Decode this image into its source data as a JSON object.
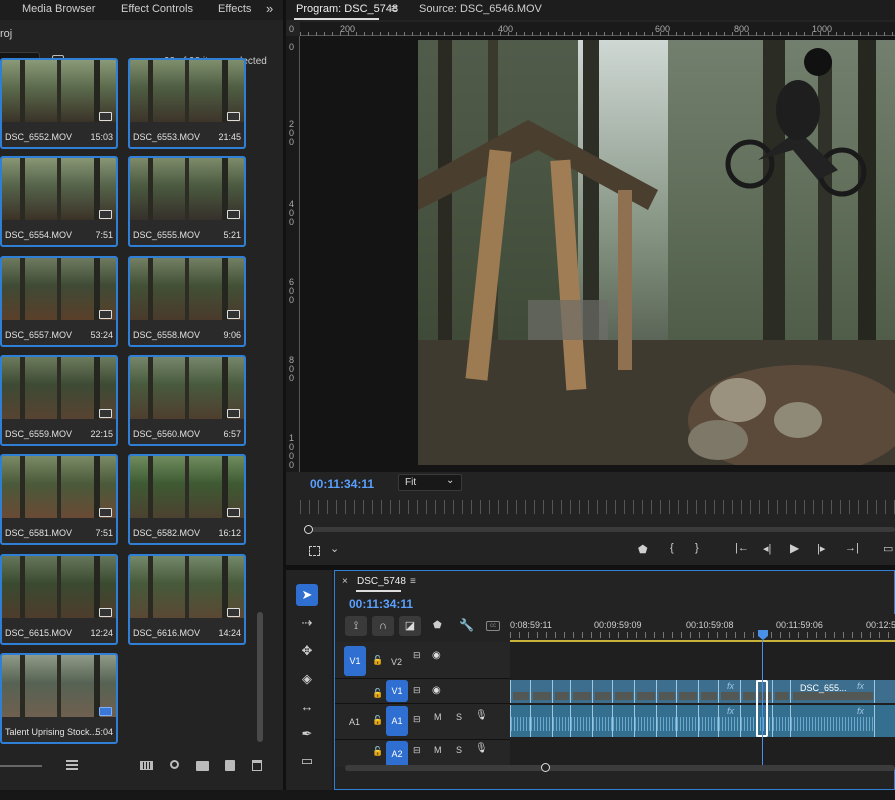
{
  "project_panel": {
    "tabs": [
      "Media Browser",
      "Effect Controls",
      "Effects"
    ],
    "overflow": "»",
    "breadcrumb": "roj",
    "items_selected": "98 of 98 items selected",
    "clips": [
      {
        "name": "DSC_6552.MOV",
        "duration": "15:03"
      },
      {
        "name": "DSC_6553.MOV",
        "duration": "21:45"
      },
      {
        "name": "DSC_6554.MOV",
        "duration": "7:51"
      },
      {
        "name": "DSC_6555.MOV",
        "duration": "5:21"
      },
      {
        "name": "DSC_6557.MOV",
        "duration": "53:24"
      },
      {
        "name": "DSC_6558.MOV",
        "duration": "9:06"
      },
      {
        "name": "DSC_6559.MOV",
        "duration": "22:15"
      },
      {
        "name": "DSC_6560.MOV",
        "duration": "6:57"
      },
      {
        "name": "DSC_6581.MOV",
        "duration": "7:51"
      },
      {
        "name": "DSC_6582.MOV",
        "duration": "16:12"
      },
      {
        "name": "DSC_6615.MOV",
        "duration": "12:24"
      },
      {
        "name": "DSC_6616.MOV",
        "duration": "14:24"
      },
      {
        "name": "Talent Uprising Stock...",
        "duration": "5:04"
      }
    ]
  },
  "program_monitor": {
    "program_tab": "Program: DSC_5748",
    "source_tab": "Source: DSC_6546.MOV",
    "ruler_h": [
      "200",
      "400",
      "600",
      "800",
      "1000"
    ],
    "ruler_v": [
      "200",
      "400",
      "600",
      "800",
      "1000"
    ],
    "timecode": "00:11:34:11",
    "fit_option": "Fit"
  },
  "timeline": {
    "sequence_name": "DSC_5748",
    "timecode": "00:11:34:11",
    "times": [
      "0:08:59:11",
      "00:09:59:09",
      "00:10:59:08",
      "00:11:59:06",
      "00:12:5"
    ],
    "tracks": {
      "v2": "V2",
      "v1": "V1",
      "a1": "A1",
      "a2": "A2",
      "m": "M",
      "s": "S"
    },
    "clip_label": "DSC_655...",
    "fx": "fx"
  },
  "colors": {
    "accent": "#2f7fd6",
    "timecode": "#5aa0ff",
    "clip_video": "#3d6e8d",
    "clip_audio": "#356f8f"
  }
}
